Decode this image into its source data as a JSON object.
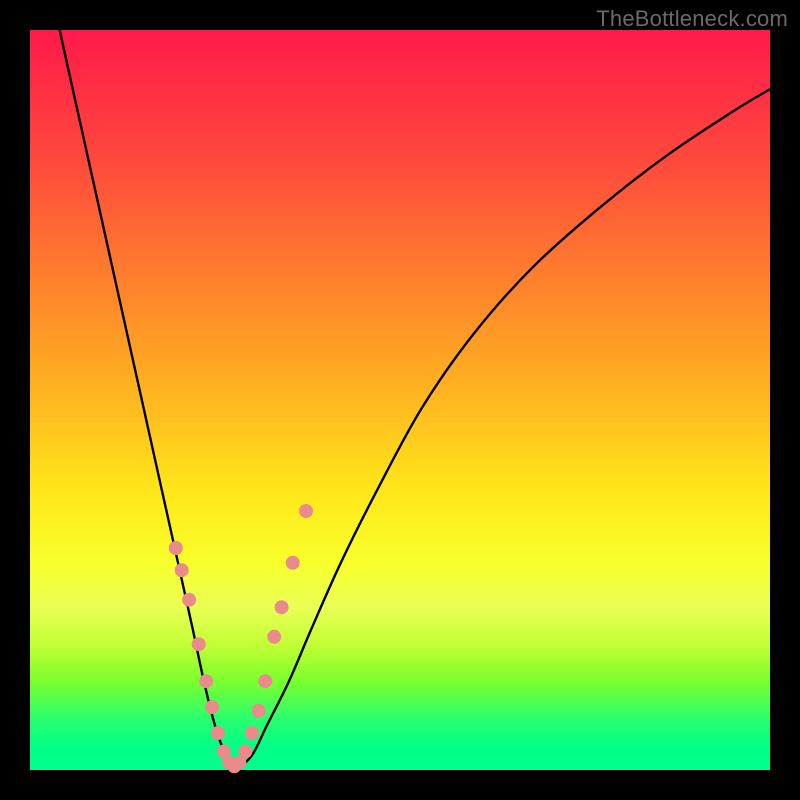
{
  "attribution": "TheBottleneck.com",
  "colors": {
    "background": "#000000",
    "curve_stroke": "#000000",
    "marker_fill": "#e98b8b",
    "marker_stroke": "#00000000"
  },
  "chart_data": {
    "type": "line",
    "title": "",
    "xlabel": "",
    "ylabel": "",
    "xlim": [
      0,
      100
    ],
    "ylim": [
      0,
      100
    ],
    "note": "Stylized bottleneck V-curve. No axes/ticks rendered. Y mapped so higher y = higher on image. Curve values estimated from pixel positions.",
    "series": [
      {
        "name": "bottleneck-curve",
        "x": [
          4,
          6,
          8,
          10,
          12,
          14,
          16,
          18,
          20,
          22,
          23.5,
          25,
          26.5,
          28,
          30,
          32,
          35,
          38,
          42,
          47,
          53,
          60,
          68,
          77,
          86,
          95,
          100
        ],
        "y": [
          100,
          91,
          82,
          73,
          64,
          55,
          46,
          37,
          28,
          19,
          12,
          6,
          2,
          0.5,
          2,
          6,
          12,
          19,
          28,
          38,
          49,
          59,
          68,
          76,
          83,
          89,
          92
        ]
      }
    ],
    "markers": {
      "name": "sweet-spot-points",
      "x": [
        19.7,
        20.5,
        21.5,
        22.8,
        23.8,
        24.6,
        25.4,
        26.2,
        26.9,
        27.6,
        28.3,
        29.1,
        30.0,
        30.9,
        31.8,
        33.0,
        34.0,
        35.5,
        37.3
      ],
      "y": [
        30,
        27,
        23,
        17,
        12,
        8.5,
        5,
        2.5,
        1,
        0.5,
        1,
        2.5,
        5,
        8,
        12,
        18,
        22,
        28,
        35
      ],
      "radius_px": 7
    }
  }
}
